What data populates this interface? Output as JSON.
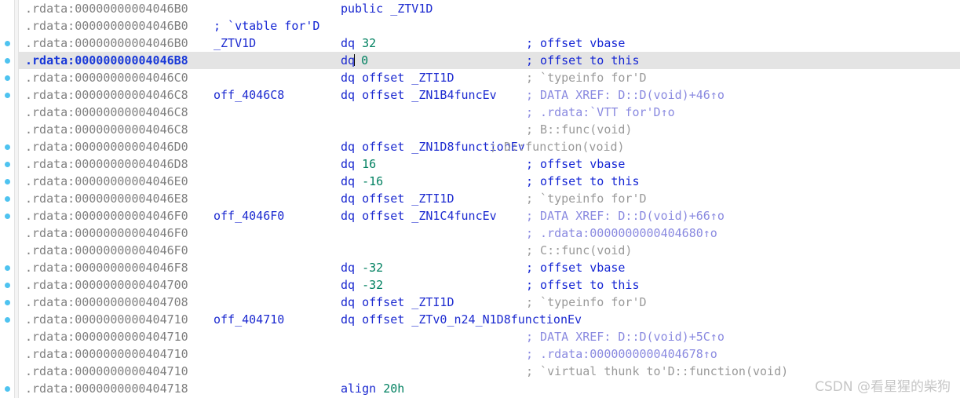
{
  "view": {
    "name": "IDA Pro disassembly view",
    "segment": ".rdata",
    "colors": {
      "background": "#ffffff",
      "selection": "#e4e4e4",
      "address": "#808080",
      "address_highlight": "#1838d8",
      "keyword": "#1c2ad0",
      "number": "#008060",
      "comment": "#1526d4",
      "comment_repeatable": "#9a9a9a",
      "comment_xref": "#8a8ae0",
      "gutter_dot": "#4ec3f0",
      "gutter_rule": "#f4f4f4"
    }
  },
  "watermark": {
    "text": "CSDN @看星猩的柴狗"
  },
  "rows": [
    {
      "dot": false,
      "selected": false,
      "address": ".rdata:00000000004046B0",
      "label": "",
      "instruction": "public _ZTV1D",
      "instruction_kind": "keyword",
      "comment": "",
      "comment_kind": ""
    },
    {
      "dot": false,
      "selected": false,
      "address": ".rdata:00000000004046B0",
      "label": "; `vtable for'D",
      "label_kind": "comment",
      "instruction": "",
      "instruction_kind": "",
      "comment": "",
      "comment_kind": ""
    },
    {
      "dot": true,
      "selected": false,
      "address": ".rdata:00000000004046B0",
      "label": "_ZTV1D",
      "instruction": "dq 32",
      "instruction_kind": "dq-num",
      "comment": "; offset vbase",
      "comment_kind": "blue"
    },
    {
      "dot": true,
      "selected": true,
      "address": ".rdata:00000000004046B8",
      "label": "",
      "instruction": "dq 0",
      "instruction_kind": "dq-num-caret",
      "comment": "; offset to this",
      "comment_kind": "blue"
    },
    {
      "dot": true,
      "selected": false,
      "address": ".rdata:00000000004046C0",
      "label": "",
      "instruction": "dq offset _ZTI1D",
      "instruction_kind": "keyword",
      "comment": "; `typeinfo for'D",
      "comment_kind": "gray"
    },
    {
      "dot": true,
      "selected": false,
      "address": ".rdata:00000000004046C8",
      "label": "off_4046C8",
      "instruction": "dq offset _ZN1B4funcEv",
      "instruction_kind": "keyword",
      "comment": "; DATA XREF: D::D(void)+46↑o",
      "comment_kind": "xref"
    },
    {
      "dot": false,
      "selected": false,
      "address": ".rdata:00000000004046C8",
      "label": "",
      "instruction": "",
      "instruction_kind": "",
      "comment": "; .rdata:`VTT for'D↑o",
      "comment_kind": "xref"
    },
    {
      "dot": false,
      "selected": false,
      "address": ".rdata:00000000004046C8",
      "label": "",
      "instruction": "",
      "instruction_kind": "",
      "comment": "; B::func(void)",
      "comment_kind": "gray"
    },
    {
      "dot": true,
      "selected": false,
      "address": ".rdata:00000000004046D0",
      "label": "",
      "instruction": "dq offset _ZN1D8functionEv",
      "instruction_kind": "keyword",
      "comment": "; D::function(void)",
      "comment_kind": "gray",
      "comment_left": true
    },
    {
      "dot": true,
      "selected": false,
      "address": ".rdata:00000000004046D8",
      "label": "",
      "instruction": "dq 16",
      "instruction_kind": "dq-num",
      "comment": "; offset vbase",
      "comment_kind": "blue"
    },
    {
      "dot": true,
      "selected": false,
      "address": ".rdata:00000000004046E0",
      "label": "",
      "instruction": "dq -16",
      "instruction_kind": "dq-num",
      "comment": "; offset to this",
      "comment_kind": "blue"
    },
    {
      "dot": true,
      "selected": false,
      "address": ".rdata:00000000004046E8",
      "label": "",
      "instruction": "dq offset _ZTI1D",
      "instruction_kind": "keyword",
      "comment": "; `typeinfo for'D",
      "comment_kind": "gray"
    },
    {
      "dot": true,
      "selected": false,
      "address": ".rdata:00000000004046F0",
      "label": "off_4046F0",
      "instruction": "dq offset _ZN1C4funcEv",
      "instruction_kind": "keyword",
      "comment": "; DATA XREF: D::D(void)+66↑o",
      "comment_kind": "xref"
    },
    {
      "dot": false,
      "selected": false,
      "address": ".rdata:00000000004046F0",
      "label": "",
      "instruction": "",
      "instruction_kind": "",
      "comment": "; .rdata:0000000000404680↑o",
      "comment_kind": "xref"
    },
    {
      "dot": false,
      "selected": false,
      "address": ".rdata:00000000004046F0",
      "label": "",
      "instruction": "",
      "instruction_kind": "",
      "comment": "; C::func(void)",
      "comment_kind": "gray"
    },
    {
      "dot": true,
      "selected": false,
      "address": ".rdata:00000000004046F8",
      "label": "",
      "instruction": "dq -32",
      "instruction_kind": "dq-num",
      "comment": "; offset vbase",
      "comment_kind": "blue"
    },
    {
      "dot": true,
      "selected": false,
      "address": ".rdata:0000000000404700",
      "label": "",
      "instruction": "dq -32",
      "instruction_kind": "dq-num",
      "comment": "; offset to this",
      "comment_kind": "blue"
    },
    {
      "dot": true,
      "selected": false,
      "address": ".rdata:0000000000404708",
      "label": "",
      "instruction": "dq offset _ZTI1D",
      "instruction_kind": "keyword",
      "comment": "; `typeinfo for'D",
      "comment_kind": "gray"
    },
    {
      "dot": true,
      "selected": false,
      "address": ".rdata:0000000000404710",
      "label": "off_404710",
      "instruction": "dq offset _ZTv0_n24_N1D8functionEv",
      "instruction_kind": "keyword",
      "comment": "",
      "comment_kind": ""
    },
    {
      "dot": false,
      "selected": false,
      "address": ".rdata:0000000000404710",
      "label": "",
      "instruction": "",
      "instruction_kind": "",
      "comment": "; DATA XREF: D::D(void)+5C↑o",
      "comment_kind": "xref"
    },
    {
      "dot": false,
      "selected": false,
      "address": ".rdata:0000000000404710",
      "label": "",
      "instruction": "",
      "instruction_kind": "",
      "comment": "; .rdata:0000000000404678↑o",
      "comment_kind": "xref"
    },
    {
      "dot": false,
      "selected": false,
      "address": ".rdata:0000000000404710",
      "label": "",
      "instruction": "",
      "instruction_kind": "",
      "comment": "; `virtual thunk to'D::function(void)",
      "comment_kind": "gray"
    },
    {
      "dot": true,
      "selected": false,
      "address": ".rdata:0000000000404718",
      "label": "",
      "instruction": "align 20h",
      "instruction_kind": "align",
      "comment": "",
      "comment_kind": ""
    }
  ]
}
